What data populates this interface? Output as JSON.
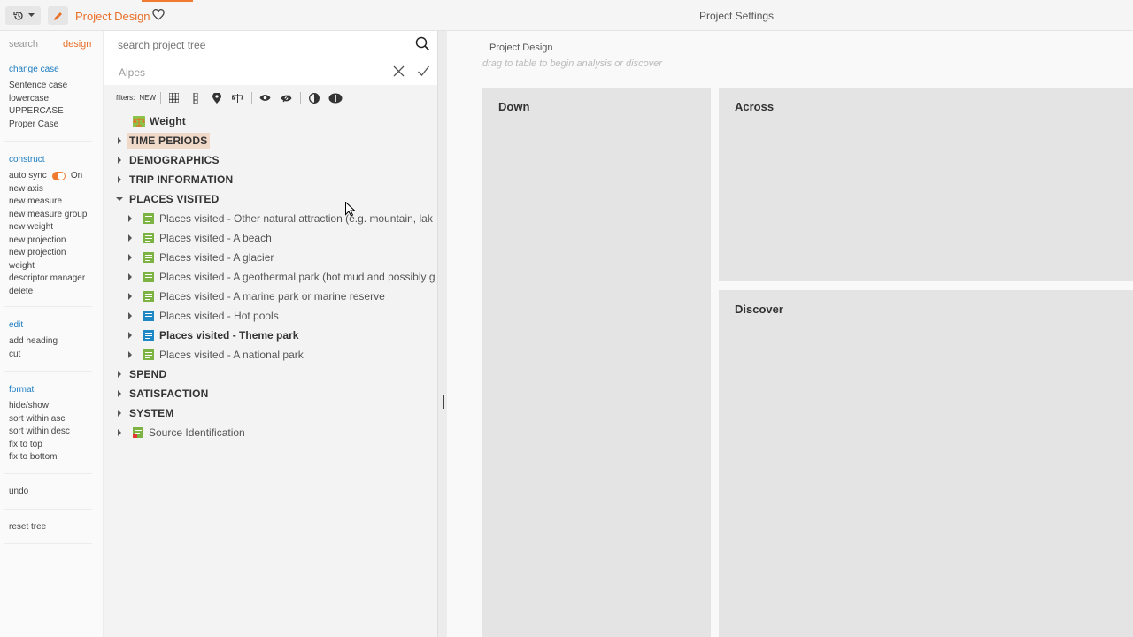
{
  "topbar": {
    "project_title": "Project Design",
    "settings_title": "Project Settings"
  },
  "leftcol": {
    "tabs": {
      "search": "search",
      "design": "design"
    },
    "change_case": {
      "head": "change case",
      "items": [
        "Sentence case",
        "lowercase",
        "UPPERCASE",
        "Proper Case"
      ]
    },
    "construct": {
      "head": "construct",
      "auto_sync_label": "auto sync",
      "auto_sync_state": "On",
      "items": [
        "new axis",
        "new measure",
        "new measure group",
        "new weight",
        "new projection",
        "new projection weight",
        "descriptor manager",
        "delete"
      ]
    },
    "edit": {
      "head": "edit",
      "items": [
        "add heading",
        "cut"
      ]
    },
    "format": {
      "head": "format",
      "items": [
        "hide/show",
        "sort within asc",
        "sort within desc",
        "fix to top",
        "fix to bottom"
      ]
    },
    "undo": "undo",
    "reset_tree": "reset tree"
  },
  "midpanel": {
    "search_placeholder": "search project tree",
    "filter_value": "Alpes",
    "filters_label": "filters:",
    "filters_new": "NEW"
  },
  "tree": {
    "weight": "Weight",
    "groups": {
      "time_periods": "TIME PERIODS",
      "demographics": "DEMOGRAPHICS",
      "trip_information": "TRIP INFORMATION",
      "places_visited": "PLACES VISITED",
      "spend": "SPEND",
      "satisfaction": "SATISFACTION",
      "system": "SYSTEM"
    },
    "places_items": [
      "Places visited - Other natural attraction (e.g. mountain, lak",
      "Places visited - A beach",
      "Places visited - A glacier",
      "Places visited - A geothermal park (hot mud and possibly g",
      "Places visited - A marine park or marine reserve",
      "Places visited - Hot pools",
      "Places visited - Theme park",
      "Places visited - A national park"
    ],
    "source_identification": "Source Identification"
  },
  "workspace": {
    "title": "Project Design",
    "hint": "drag to table to begin analysis or discover",
    "zones": {
      "down": "Down",
      "across": "Across",
      "discover": "Discover"
    }
  },
  "colors": {
    "accent": "#e8702a",
    "link_blue": "#1a7bc0",
    "item_green": "#7cb342",
    "item_blue": "#1e88c7",
    "highlight": "#f1d9c9"
  }
}
